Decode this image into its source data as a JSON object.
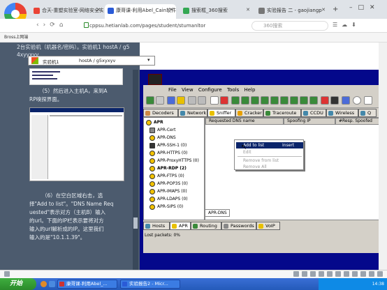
{
  "browser": {
    "tabs": [
      {
        "label": "合天-重塑实验室-网络安全实验室",
        "color": "#ea4335",
        "active": false
      },
      {
        "label": "康哥课-利用Abel_Cain软件实现DN",
        "color": "#2a5bd7",
        "active": true
      },
      {
        "label": "搜索框_360搜索",
        "color": "#34a853",
        "active": false
      },
      {
        "label": "实验报告 二 - gaojiangp",
        "color": "#777777",
        "active": false
      }
    ],
    "url": "cppsu.hetianlab.com/pages/student/stumanltor",
    "search_placeholder": "360搜索",
    "bookmark": "Bross上网端"
  },
  "lab": {
    "top_text": "2台实验机（机器名/密码）。实验机1  hostA / g5",
    "top_text2": "4xyyxyv",
    "conn_label": "实验机1",
    "conn_value": "hostA / g5xyxyv",
    "step5": "（5）然后进入主机A，来到A",
    "step5b": "RP嗅探界面。",
    "step6": [
      "（6）在空白区域右击，选",
      "择\"Add to list\"。\"DNS Name Req",
      "uested\"表示对方（主机B）输入",
      "的url。下面的IP栏表示要将对方",
      "输入的url解析成的IP。这里我们",
      "输入的是\"10.1.1.39\"。"
    ]
  },
  "app": {
    "menu": [
      "File",
      "View",
      "Configure",
      "Tools",
      "Help"
    ],
    "tabs_top": [
      "Decoders",
      "Network",
      "Sniffer",
      "Cracker",
      "Traceroute",
      "CCDU",
      "Wireless",
      "Q"
    ],
    "tree": [
      "APR",
      "APR-Cert",
      "APR-DNS",
      "APR-SSH-1  (0)",
      "APR-HTTPS  (0)",
      "APR-ProxyHTTPS  (0)",
      "APR-RDP  (2)",
      "APR-FTPS  (0)",
      "APR-POP3S  (0)",
      "APR-IMAPS  (0)",
      "APR-LDAPS  (0)",
      "APR-SIPS  (0)"
    ],
    "columns": [
      "Requested DNS name",
      "Spoofing IP",
      "#Resp. Spoofed"
    ],
    "context_menu": [
      {
        "label": "Add to list",
        "shortcut": "Insert",
        "highlighted": true
      },
      {
        "label": "Edit",
        "shortcut": "",
        "highlighted": false
      },
      {
        "label": "Remove from list",
        "shortcut": "",
        "highlighted": false
      },
      {
        "label": "Remove All",
        "shortcut": "",
        "highlighted": false
      }
    ],
    "subtab": "APR-DNS",
    "tabs_bottom": [
      "Hosts",
      "APR",
      "Routing",
      "Passwords",
      "VoIP"
    ],
    "status": "Lost packets:    0%"
  },
  "taskbar": {
    "start": "开始",
    "tasks": [
      "康哥课-利用Abel_...",
      "实验报告2 - Micr..."
    ],
    "clock": "14:38"
  }
}
